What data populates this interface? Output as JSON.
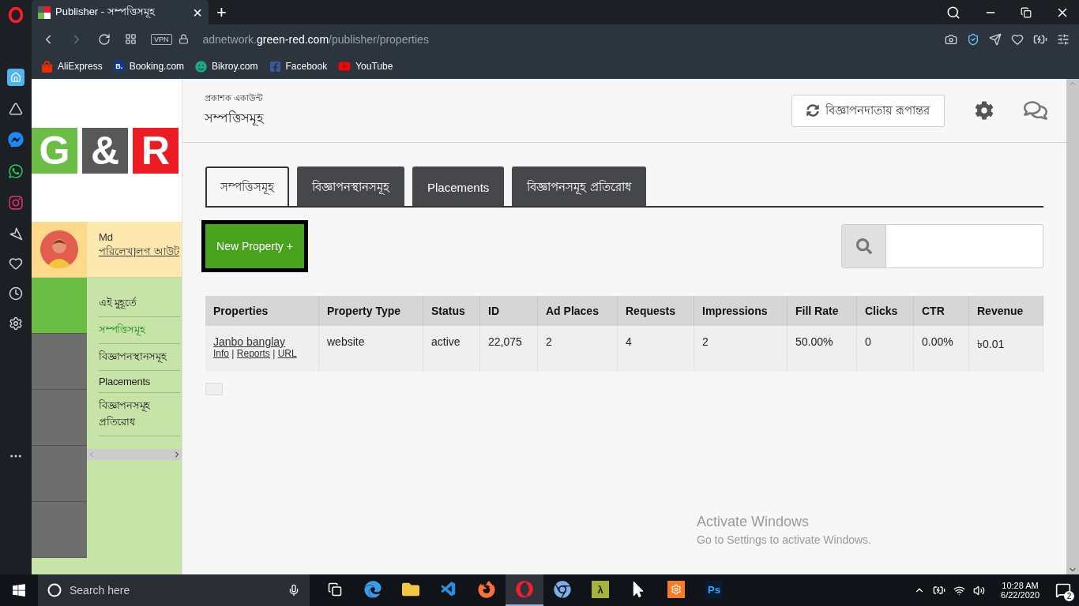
{
  "browser": {
    "tab": {
      "title": "Publisher - সম্পত্তিসমূহ",
      "close": "×",
      "new_tab": "+"
    },
    "address": {
      "vpn": "VPN",
      "prefix": "adnetwork.",
      "host": "green-red.com",
      "path": "/publisher/properties"
    },
    "bookmarks": [
      {
        "kind": "ali",
        "label": "AliExpress"
      },
      {
        "kind": "booking",
        "label": "Booking.com",
        "icon_text": "B."
      },
      {
        "kind": "bikroy",
        "label": "Bikroy.com"
      },
      {
        "kind": "facebook",
        "label": "Facebook"
      },
      {
        "kind": "youtube",
        "label": "YouTube"
      }
    ]
  },
  "logo": [
    {
      "letter": "G",
      "color": "#6cbd45"
    },
    {
      "letter": "&",
      "color": "#58585a"
    },
    {
      "letter": "R",
      "color": "#ed1c24"
    }
  ],
  "user": {
    "name": "Md",
    "profile_link": "পরিলেখ",
    "separator": "|",
    "logout_link": "লগ আউট"
  },
  "menu": [
    {
      "label": "এই মুহূর্তে",
      "selected": false
    },
    {
      "label": "সম্পত্তিসমূহ",
      "selected": true
    },
    {
      "label": "বিজ্ঞাপনস্থানসমূহ",
      "selected": false
    },
    {
      "label": "Placements",
      "selected": false
    },
    {
      "label": "বিজ্ঞাপনসমূহ প্রতিরোধ",
      "selected": false
    }
  ],
  "header": {
    "subtitle": "প্রকাশক একাউন্ট",
    "title": "সম্পত্তিসমূহ",
    "switch_button": "বিজ্ঞাপনদাতায় রূপান্তর"
  },
  "tabs": [
    {
      "label": "সম্পত্তিসমূহ",
      "selected": true
    },
    {
      "label": "বিজ্ঞাপনস্থানসমূহ",
      "selected": false
    },
    {
      "label": "Placements",
      "selected": false
    },
    {
      "label": "বিজ্ঞাপনসমূহ প্রতিরোধ",
      "selected": false
    }
  ],
  "new_property": "New Property +",
  "table": {
    "columns": [
      "Properties",
      "Property Type",
      "Status",
      "ID",
      "Ad Places",
      "Requests",
      "Impressions",
      "Fill Rate",
      "Clicks",
      "CTR",
      "Revenue"
    ],
    "rows": [
      {
        "cells": [
          {
            "kind": "links",
            "name": "Janbo banglay",
            "links": [
              "Info",
              "Reports",
              "URL"
            ],
            "separator": "|"
          },
          "website",
          "active",
          "22,075",
          "2",
          "4",
          "2",
          "50.00%",
          "0",
          "0.00%",
          "৳0.01"
        ]
      }
    ]
  },
  "watermark": {
    "title": "Activate Windows",
    "text": "Go to Settings to activate Windows."
  },
  "taskbar": {
    "search_placeholder": "Search here",
    "apps": [
      {
        "kind": "edge",
        "selected": false
      },
      {
        "kind": "folder",
        "selected": false
      },
      {
        "kind": "code",
        "selected": false
      },
      {
        "kind": "firefox",
        "selected": false
      },
      {
        "kind": "opera",
        "selected": true
      },
      {
        "kind": "chrome",
        "selected": false
      },
      {
        "kind": "lambda",
        "text": "λ",
        "selected": false
      },
      {
        "kind": "cursor",
        "selected": false
      },
      {
        "kind": "xampp",
        "selected": false
      },
      {
        "kind": "ps",
        "text": "Ps",
        "selected": false
      }
    ],
    "time": "10:28 AM",
    "date": "6/22/2020",
    "notifications": "2"
  }
}
